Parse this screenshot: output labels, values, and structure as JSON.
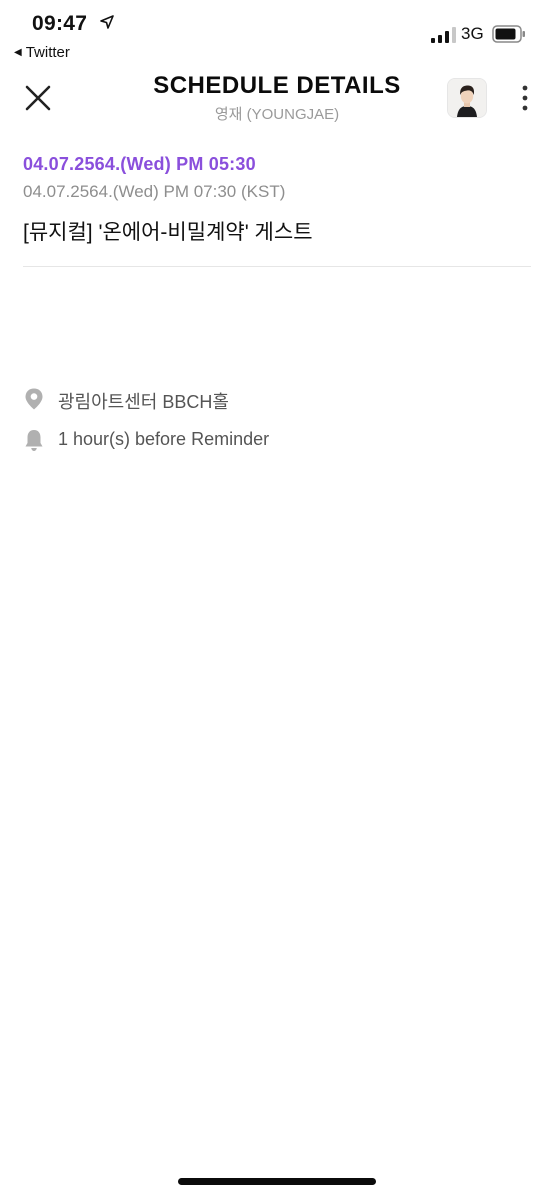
{
  "status_bar": {
    "time": "09:47",
    "back_app": "Twitter",
    "network": "3G"
  },
  "header": {
    "title": "SCHEDULE DETAILS",
    "subtitle": "영재 (YOUNGJAE)"
  },
  "schedule": {
    "start_time": "04.07.2564.(Wed) PM 05:30",
    "end_time": "04.07.2564.(Wed) PM 07:30 (KST)",
    "title": "[뮤지컬] '온에어-비밀계약' 게스트",
    "location": "광림아트센터 BBCH홀",
    "reminder": "1 hour(s) before Reminder"
  },
  "colors": {
    "accent": "#8a4fdc",
    "secondary_text": "#8e8e8e",
    "icon_gray": "#b0b0b0"
  },
  "icons": {
    "close": "close-icon",
    "more": "more-vertical-icon",
    "location": "map-pin-icon",
    "reminder": "bell-icon"
  }
}
